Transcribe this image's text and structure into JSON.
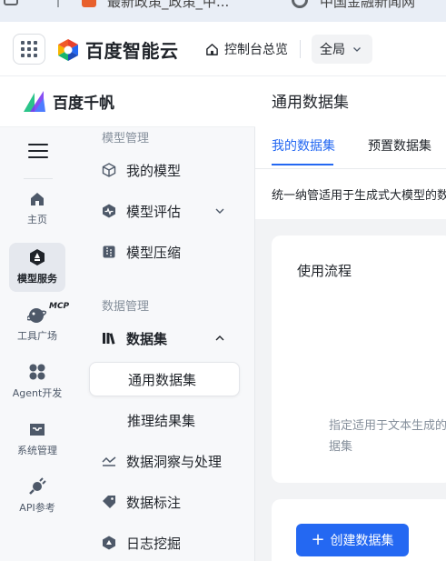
{
  "browser": {
    "tab_title": "最新政策_政策_中...",
    "tab2_title": "中国金融新闻网"
  },
  "topbar": {
    "brand_name": "百度智能云",
    "console_label": "控制台总览",
    "region_label": "全局"
  },
  "product": {
    "name": "百度千帆"
  },
  "rail": {
    "items": [
      {
        "label": "主页",
        "icon": "home-icon"
      },
      {
        "label": "模型服务",
        "icon": "model-service-icon"
      },
      {
        "label": "工具广场",
        "icon": "tools-icon",
        "badge": "MCP"
      },
      {
        "label": "Agent开发",
        "icon": "agent-icon"
      },
      {
        "label": "系统管理",
        "icon": "inbox-icon"
      },
      {
        "label": "API参考",
        "icon": "api-plug-icon"
      }
    ]
  },
  "submenu": {
    "group_model": "模型管理",
    "my_models": "我的模型",
    "model_eval": "模型评估",
    "model_compress": "模型压缩",
    "group_data": "数据管理",
    "datasets": "数据集",
    "general_datasets": "通用数据集",
    "inference_results": "推理结果集",
    "data_insight": "数据洞察与处理",
    "data_labeling": "数据标注",
    "log_mining": "日志挖掘"
  },
  "main": {
    "title": "通用数据集",
    "tabs": [
      "我的数据集",
      "预置数据集"
    ],
    "description": "统一纳管适用于生成式大模型的数据集",
    "workflow_title": "使用流程",
    "workflow_note": "指定适用于文本生成的数据集",
    "create_button": "创建数据集"
  },
  "colors": {
    "accent": "#2468f2",
    "rail_bg": "#f7f8fa",
    "content_bg": "#f2f3f5"
  }
}
